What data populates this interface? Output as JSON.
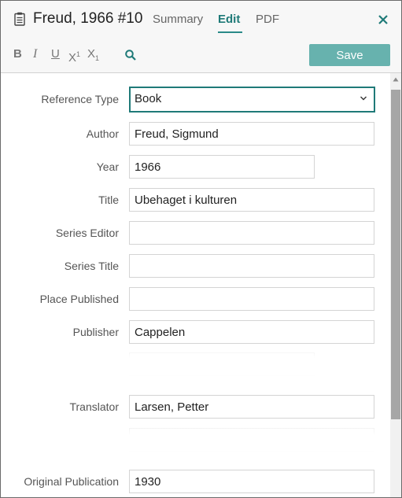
{
  "header": {
    "title": "Freud, 1966 #10",
    "tabs": [
      {
        "label": "Summary",
        "active": false
      },
      {
        "label": "Edit",
        "active": true
      },
      {
        "label": "PDF",
        "active": false
      }
    ],
    "icons": {
      "reference": "document-icon",
      "close": "close-icon"
    }
  },
  "toolbar": {
    "bold": "B",
    "italic": "I",
    "underline": "U",
    "superscript_base": "X",
    "superscript_mark": "1",
    "subscript_base": "X",
    "subscript_mark": "1",
    "search_icon": "search-icon",
    "save_label": "Save"
  },
  "fields": {
    "reference_type": {
      "label": "Reference Type",
      "value": "Book"
    },
    "author": {
      "label": "Author",
      "value": "Freud, Sigmund"
    },
    "year": {
      "label": "Year",
      "value": "1966"
    },
    "title": {
      "label": "Title",
      "value": "Ubehaget i kulturen"
    },
    "series_editor": {
      "label": "Series Editor",
      "value": ""
    },
    "series_title": {
      "label": "Series Title",
      "value": ""
    },
    "place_published": {
      "label": "Place Published",
      "value": ""
    },
    "publisher": {
      "label": "Publisher",
      "value": "Cappelen"
    },
    "translator": {
      "label": "Translator",
      "value": "Larsen, Petter"
    },
    "original_publication": {
      "label": "Original Publication",
      "value": "1930"
    }
  },
  "colors": {
    "accent": "#1f7a78",
    "save_button": "#67b2ae",
    "scroll_thumb": "#a6a6a6"
  }
}
